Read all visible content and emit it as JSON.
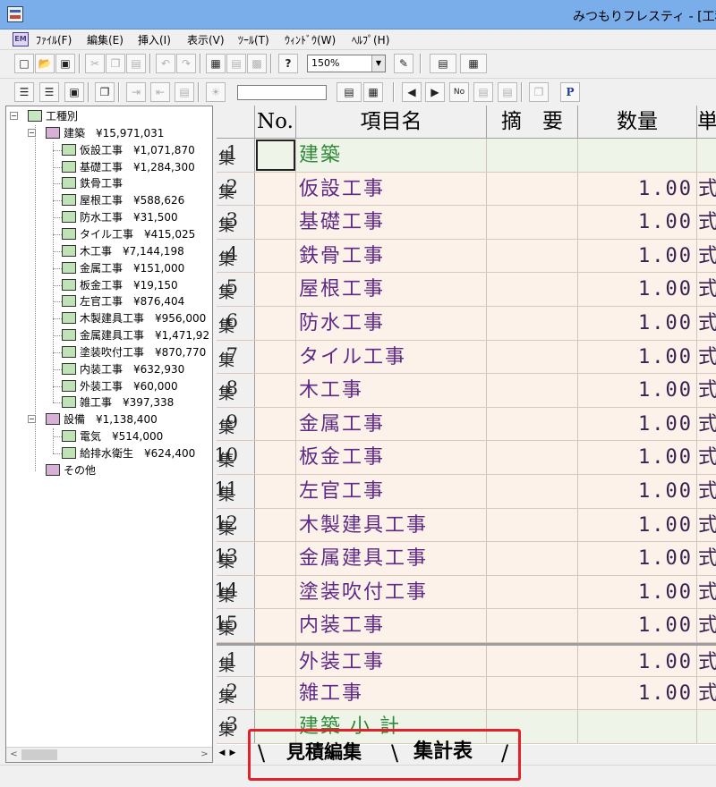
{
  "window": {
    "title": "みつもりフレスティ - [工種別"
  },
  "menu": {
    "items": [
      {
        "label": "ﾌｧｲﾙ(F)"
      },
      {
        "label": "編集(E)"
      },
      {
        "label": "挿入(I)"
      },
      {
        "label": "表示(V)"
      },
      {
        "label": "ﾂｰﾙ(T)"
      },
      {
        "label": "ｳｨﾝﾄﾞｳ(W)"
      },
      {
        "label": "ﾍﾙﾌﾟ(H)"
      }
    ]
  },
  "toolbar": {
    "zoom_value": "150%",
    "help_icon": "?",
    "p_icon": "P",
    "no_icon": "No"
  },
  "tree": {
    "root": "工種別",
    "categories": [
      {
        "label": "建築　¥15,971,031",
        "children": [
          "仮設工事　¥1,071,870",
          "基礎工事　¥1,284,300",
          "鉄骨工事",
          "屋根工事　¥588,626",
          "防水工事　¥31,500",
          "タイル工事　¥415,025",
          "木工事　¥7,144,198",
          "金属工事　¥151,000",
          "板金工事　¥19,150",
          "左官工事　¥876,404",
          "木製建具工事　¥956,000",
          "金属建具工事　¥1,471,92",
          "塗装吹付工事　¥870,770",
          "内装工事　¥632,930",
          "外装工事　¥60,000",
          "雑工事　¥397,338"
        ]
      },
      {
        "label": "設備　¥1,138,400",
        "children": [
          "電気　¥514,000",
          "給排水衛生　¥624,400"
        ]
      },
      {
        "label": "その他",
        "children": []
      }
    ]
  },
  "grid": {
    "headers": {
      "no": "No.",
      "name": "項目名",
      "memo": "摘　要",
      "qty": "数量",
      "unit": "単"
    },
    "rows": [
      {
        "hdr_ja": "集",
        "hdr_num": "1",
        "name": "建築",
        "qty": "",
        "unit": "",
        "kind": "sub"
      },
      {
        "hdr_ja": "集",
        "hdr_num": "2",
        "name": "仮設工事",
        "qty": "1.00",
        "unit": "式",
        "kind": "item"
      },
      {
        "hdr_ja": "集",
        "hdr_num": "3",
        "name": "基礎工事",
        "qty": "1.00",
        "unit": "式",
        "kind": "item"
      },
      {
        "hdr_ja": "集",
        "hdr_num": "4",
        "name": "鉄骨工事",
        "qty": "1.00",
        "unit": "式",
        "kind": "item"
      },
      {
        "hdr_ja": "集",
        "hdr_num": "5",
        "name": "屋根工事",
        "qty": "1.00",
        "unit": "式",
        "kind": "item"
      },
      {
        "hdr_ja": "集",
        "hdr_num": "6",
        "name": "防水工事",
        "qty": "1.00",
        "unit": "式",
        "kind": "item"
      },
      {
        "hdr_ja": "集",
        "hdr_num": "7",
        "name": "タイル工事",
        "qty": "1.00",
        "unit": "式",
        "kind": "item"
      },
      {
        "hdr_ja": "集",
        "hdr_num": "8",
        "name": "木工事",
        "qty": "1.00",
        "unit": "式",
        "kind": "item"
      },
      {
        "hdr_ja": "集",
        "hdr_num": "9",
        "name": "金属工事",
        "qty": "1.00",
        "unit": "式",
        "kind": "item"
      },
      {
        "hdr_ja": "集",
        "hdr_num": "10",
        "name": "板金工事",
        "qty": "1.00",
        "unit": "式",
        "kind": "item"
      },
      {
        "hdr_ja": "集",
        "hdr_num": "11",
        "name": "左官工事",
        "qty": "1.00",
        "unit": "式",
        "kind": "item"
      },
      {
        "hdr_ja": "集",
        "hdr_num": "12",
        "name": "木製建具工事",
        "qty": "1.00",
        "unit": "式",
        "kind": "item"
      },
      {
        "hdr_ja": "集",
        "hdr_num": "13",
        "name": "金属建具工事",
        "qty": "1.00",
        "unit": "式",
        "kind": "item"
      },
      {
        "hdr_ja": "集",
        "hdr_num": "14",
        "name": "塗装吹付工事",
        "qty": "1.00",
        "unit": "式",
        "kind": "item"
      },
      {
        "hdr_ja": "集",
        "hdr_num": "15",
        "name": "内装工事",
        "qty": "1.00",
        "unit": "式",
        "kind": "item"
      },
      {
        "hdr_ja": "集",
        "hdr_num": "1",
        "name": "外装工事",
        "qty": "1.00",
        "unit": "式",
        "kind": "item"
      },
      {
        "hdr_ja": "集",
        "hdr_num": "2",
        "name": "雑工事",
        "qty": "1.00",
        "unit": "式",
        "kind": "item"
      },
      {
        "hdr_ja": "集",
        "hdr_num": "3",
        "name": "建築 小 計",
        "qty": "",
        "unit": "",
        "kind": "sub"
      }
    ]
  },
  "tabs": [
    {
      "label": "見積編集",
      "active": false
    },
    {
      "label": "集計表",
      "active": true
    }
  ],
  "colors": {
    "title_bar": "#7aaeea",
    "item_name": "#5e2a86",
    "subtotal_name": "#2e8b3a",
    "item_bg": "#fdf2ea",
    "subtotal_bg": "#eef5e8",
    "highlight": "#e3212b"
  }
}
